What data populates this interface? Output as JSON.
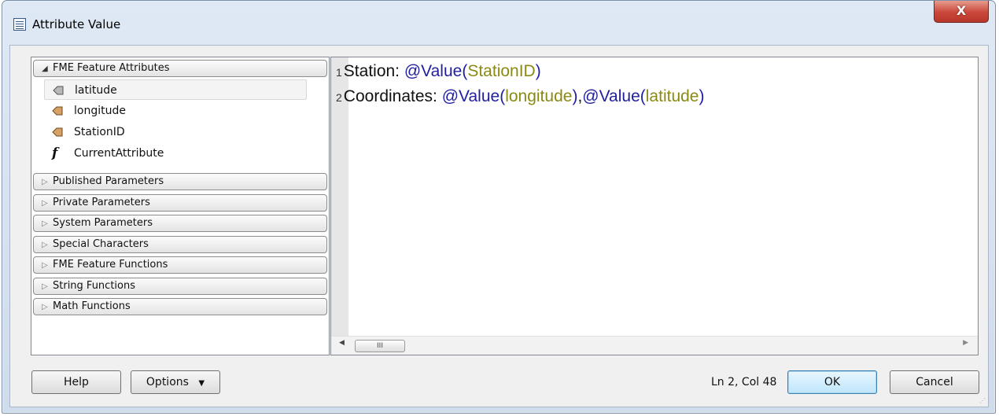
{
  "window": {
    "title": "Attribute Value",
    "close_glyph": "X"
  },
  "tree": {
    "expanded_group": {
      "label": "FME Feature Attributes",
      "arrow": "◢"
    },
    "attributes": [
      {
        "label": "latitude",
        "icon": "attribute-icon",
        "selected": true
      },
      {
        "label": "longitude",
        "icon": "attribute-icon"
      },
      {
        "label": "StationID",
        "icon": "attribute-icon"
      },
      {
        "label": "CurrentAttribute",
        "icon": "function-icon",
        "glyph": "f"
      }
    ],
    "collapsed_groups": [
      "Published Parameters",
      "Private Parameters",
      "System Parameters",
      "Special Characters",
      "FME Feature Functions",
      "String Functions",
      "Math Functions"
    ],
    "collapsed_arrow": "▷"
  },
  "editor": {
    "lines": [
      {
        "number": "1",
        "prefix": "Station: ",
        "func": "@Value",
        "open": "(",
        "arg": "StationID",
        "close": ")"
      },
      {
        "number": "2",
        "prefix": "Coordinates: ",
        "func1": "@Value",
        "open1": "(",
        "arg1": "longitude",
        "close1": ")",
        "sep": ",",
        "func2": "@Value",
        "open2": "(",
        "arg2": "latitude",
        "close2": ")"
      }
    ],
    "scroll": {
      "left_arrow": "◀",
      "right_arrow": "▶",
      "thumb_grip": "III"
    }
  },
  "footer": {
    "help_label": "Help",
    "options_label": "Options",
    "options_arrow": "▼",
    "status": "Ln 2, Col 48",
    "ok_label": "OK",
    "cancel_label": "Cancel"
  },
  "colors": {
    "function": "#1f1fa0",
    "argument": "#8a8a12",
    "close_button": "#c9473a"
  }
}
